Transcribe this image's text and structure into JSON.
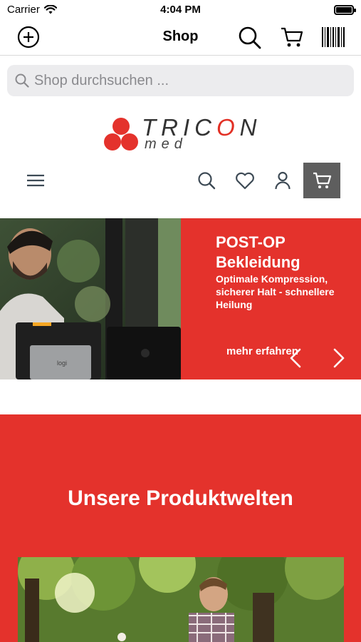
{
  "status_bar": {
    "carrier": "Carrier",
    "time": "4:04 PM"
  },
  "nav_bar": {
    "title": "Shop"
  },
  "search": {
    "placeholder": "Shop durchsuchen ..."
  },
  "logo": {
    "word_prefix": "TRIC",
    "word_o": "O",
    "word_suffix": "N",
    "sub": "med"
  },
  "hero": {
    "title": "POST-OP Bekleidung",
    "subtitle": "Optimale Kompression, sicherer Halt - schnellere Heilung",
    "cta": "mehr erfahren"
  },
  "product_worlds": {
    "title": "Unsere Produktwelten"
  },
  "colors": {
    "brand_red": "#e4322c",
    "dark_gray": "#5e5e5e",
    "search_bg": "#ececee"
  },
  "icons": [
    "wifi-icon",
    "battery-icon",
    "add-icon",
    "search-icon",
    "cart-icon",
    "barcode-icon",
    "menu-icon",
    "heart-icon",
    "user-icon",
    "chevron-left-icon",
    "chevron-right-icon"
  ]
}
